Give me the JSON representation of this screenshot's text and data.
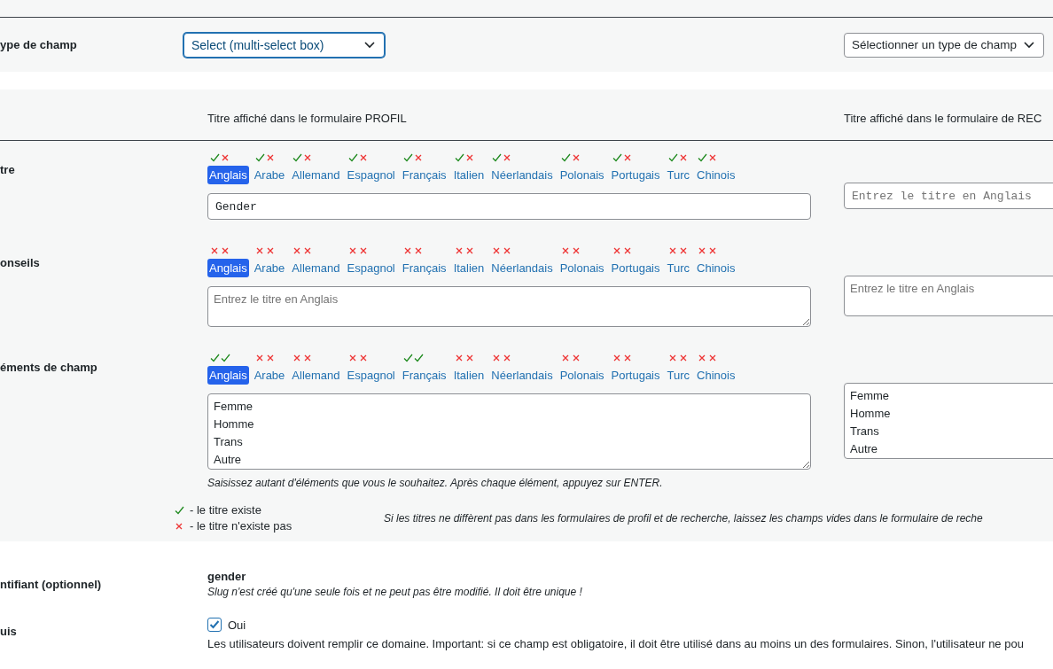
{
  "field_type": {
    "label": "ype de champ",
    "profile_select": "Select (multi-select box)",
    "search_select": "Sélectionner un type de champ"
  },
  "headers": {
    "profile": "Titre affiché dans le formulaire PROFIL",
    "search": "Titre affiché dans le formulaire de REC"
  },
  "rows": [
    {
      "label": "tre",
      "kind": "input",
      "languages": [
        {
          "name": "Anglais",
          "profile": true,
          "search": false,
          "selected": true
        },
        {
          "name": "Arabe",
          "profile": true,
          "search": false,
          "selected": false
        },
        {
          "name": "Allemand",
          "profile": true,
          "search": false,
          "selected": false
        },
        {
          "name": "Espagnol",
          "profile": true,
          "search": false,
          "selected": false
        },
        {
          "name": "Français",
          "profile": true,
          "search": false,
          "selected": false
        },
        {
          "name": "Italien",
          "profile": true,
          "search": false,
          "selected": false
        },
        {
          "name": "Néerlandais",
          "profile": true,
          "search": false,
          "selected": false
        },
        {
          "name": "Polonais",
          "profile": true,
          "search": false,
          "selected": false
        },
        {
          "name": "Portugais",
          "profile": true,
          "search": false,
          "selected": false
        },
        {
          "name": "Turc",
          "profile": true,
          "search": false,
          "selected": false
        },
        {
          "name": "Chinois",
          "profile": true,
          "search": false,
          "selected": false
        }
      ],
      "profile_value": "Gender",
      "search_placeholder": "Entrez le titre en Anglais"
    },
    {
      "label": "onseils",
      "kind": "textarea",
      "languages": [
        {
          "name": "Anglais",
          "profile": false,
          "search": false,
          "selected": true
        },
        {
          "name": "Arabe",
          "profile": false,
          "search": false,
          "selected": false
        },
        {
          "name": "Allemand",
          "profile": false,
          "search": false,
          "selected": false
        },
        {
          "name": "Espagnol",
          "profile": false,
          "search": false,
          "selected": false
        },
        {
          "name": "Français",
          "profile": false,
          "search": false,
          "selected": false
        },
        {
          "name": "Italien",
          "profile": false,
          "search": false,
          "selected": false
        },
        {
          "name": "Néerlandais",
          "profile": false,
          "search": false,
          "selected": false
        },
        {
          "name": "Polonais",
          "profile": false,
          "search": false,
          "selected": false
        },
        {
          "name": "Portugais",
          "profile": false,
          "search": false,
          "selected": false
        },
        {
          "name": "Turc",
          "profile": false,
          "search": false,
          "selected": false
        },
        {
          "name": "Chinois",
          "profile": false,
          "search": false,
          "selected": false
        }
      ],
      "profile_placeholder": "Entrez le titre en Anglais",
      "search_placeholder": "Entrez le titre en Anglais"
    },
    {
      "label": "éments de champ",
      "kind": "list",
      "languages": [
        {
          "name": "Anglais",
          "profile": true,
          "search": true,
          "selected": true
        },
        {
          "name": "Arabe",
          "profile": false,
          "search": false,
          "selected": false
        },
        {
          "name": "Allemand",
          "profile": false,
          "search": false,
          "selected": false
        },
        {
          "name": "Espagnol",
          "profile": false,
          "search": false,
          "selected": false
        },
        {
          "name": "Français",
          "profile": true,
          "search": true,
          "selected": false
        },
        {
          "name": "Italien",
          "profile": false,
          "search": false,
          "selected": false
        },
        {
          "name": "Néerlandais",
          "profile": false,
          "search": false,
          "selected": false
        },
        {
          "name": "Polonais",
          "profile": false,
          "search": false,
          "selected": false
        },
        {
          "name": "Portugais",
          "profile": false,
          "search": false,
          "selected": false
        },
        {
          "name": "Turc",
          "profile": false,
          "search": false,
          "selected": false
        },
        {
          "name": "Chinois",
          "profile": false,
          "search": false,
          "selected": false
        }
      ],
      "profile_lines": [
        "Femme",
        "Homme",
        "Trans",
        "Autre"
      ],
      "search_lines": [
        "Femme",
        "Homme",
        "Trans",
        "Autre"
      ],
      "hint": "Saisissez autant d'éléments que vous le souhaitez. Après chaque élément, appuyez sur ENTER."
    }
  ],
  "legend": {
    "exists": "- le titre existe",
    "missing": "- le titre n'existe pas",
    "note": "Si les titres ne diffèrent pas dans les formulaires de profil et de recherche, laissez les champs vides dans le formulaire de reche"
  },
  "identifier": {
    "label": "ntifiant (optionnel)",
    "value": "gender",
    "note": "Slug n'est créé qu'une seule fois et ne peut pas être modifié. Il doit être unique !"
  },
  "required": {
    "label": "uis",
    "checked": true,
    "option": "Oui",
    "description": "Les utilisateurs doivent remplir ce domaine. Important: si ce champ est obligatoire, il doit être utilisé dans au moins un des formulaires. Sinon, l'utilisateur ne pou"
  }
}
